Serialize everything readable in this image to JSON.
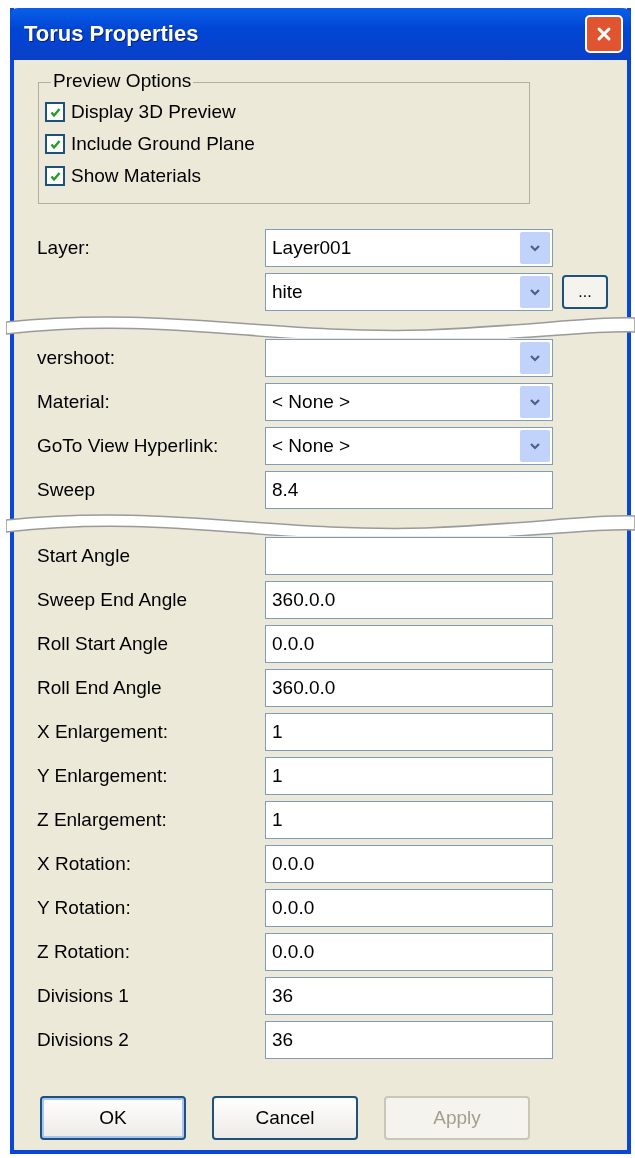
{
  "window": {
    "title": "Torus Properties"
  },
  "preview_options": {
    "title": "Preview Options",
    "options": [
      {
        "label": "Display 3D Preview",
        "checked": true
      },
      {
        "label": "Include Ground Plane",
        "checked": true
      },
      {
        "label": "Show Materials",
        "checked": true
      }
    ]
  },
  "fields": [
    {
      "kind": "dropdown",
      "label": "Layer:",
      "value": "Layer001"
    },
    {
      "kind": "dropdown",
      "value": "hite",
      "browse": "..."
    },
    {
      "kind": "tear"
    },
    {
      "kind": "dropdown",
      "label": "vershoot:"
    },
    {
      "kind": "dropdown",
      "label": "Material:",
      "value": "< None >"
    },
    {
      "kind": "dropdown",
      "label": "GoTo View Hyperlink:",
      "value": "< None >"
    },
    {
      "kind": "text",
      "label": "Sweep",
      "value": "8.4"
    },
    {
      "kind": "tear"
    },
    {
      "kind": "text",
      "label": "Start Angle"
    },
    {
      "kind": "text",
      "label": "Sweep End Angle",
      "value": "360.0.0"
    },
    {
      "kind": "text",
      "label": "Roll Start Angle",
      "value": "0.0.0"
    },
    {
      "kind": "text",
      "label": "Roll End Angle",
      "value": "360.0.0"
    },
    {
      "kind": "text",
      "label": "X Enlargement:",
      "value": "1"
    },
    {
      "kind": "text",
      "label": "Y Enlargement:",
      "value": "1"
    },
    {
      "kind": "text",
      "label": "Z Enlargement:",
      "value": "1"
    },
    {
      "kind": "text",
      "label": "X Rotation:",
      "value": "0.0.0"
    },
    {
      "kind": "text",
      "label": "Y Rotation:",
      "value": "0.0.0"
    },
    {
      "kind": "text",
      "label": "Z Rotation:",
      "value": "0.0.0"
    },
    {
      "kind": "text",
      "label": "Divisions 1",
      "value": "36"
    },
    {
      "kind": "text",
      "label": "Divisions 2",
      "value": "36"
    }
  ],
  "buttons": [
    {
      "label": "OK",
      "default": true,
      "disabled": false
    },
    {
      "label": "Cancel",
      "default": false,
      "disabled": false
    },
    {
      "label": "Apply",
      "default": false,
      "disabled": true
    }
  ]
}
